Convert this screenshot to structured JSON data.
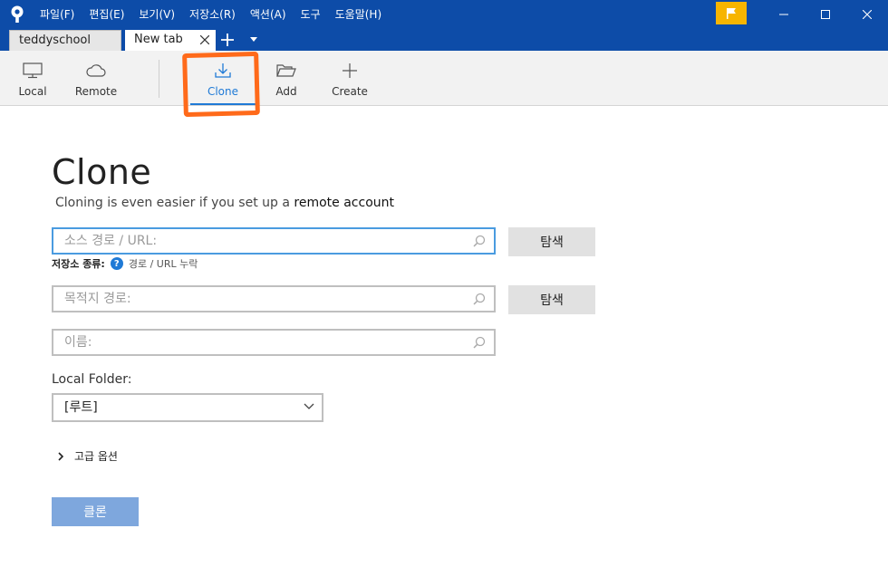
{
  "menu": [
    "파일(F)",
    "편집(E)",
    "보기(V)",
    "저장소(R)",
    "액션(A)",
    "도구",
    "도움말(H)"
  ],
  "tabs": [
    {
      "label": "teddyschool"
    },
    {
      "label": "New tab"
    }
  ],
  "toolbar": {
    "local": "Local",
    "remote": "Remote",
    "clone": "Clone",
    "add": "Add",
    "create": "Create"
  },
  "clone_page": {
    "title": "Clone",
    "subtitle_prefix": "Cloning is even easier if you set up a ",
    "subtitle_link": "remote account",
    "url_placeholder": "소스 경로 / URL:",
    "browse_label": "탐색",
    "repo_type_key": "저장소 종류:",
    "repo_type_value": "경로 / URL 누락",
    "dest_placeholder": "목적지 경로:",
    "name_placeholder": "이름:",
    "local_folder_label": "Local Folder:",
    "local_folder_value": "[루트]",
    "advanced_label": "고급 옵션",
    "clone_button": "클론"
  },
  "colors": {
    "titlebar": "#0d4ca8",
    "accent": "#1f7ad6",
    "flag": "#f7b500",
    "annotation": "#ff6a1a",
    "clone_button": "#7ea7dd"
  },
  "icons": {
    "app": "sourcetree-logo-icon",
    "flag": "flag-icon",
    "local": "monitor-icon",
    "remote": "cloud-icon",
    "clone": "download-icon",
    "add": "folder-open-icon",
    "create": "plus-icon",
    "search": "search-icon"
  }
}
